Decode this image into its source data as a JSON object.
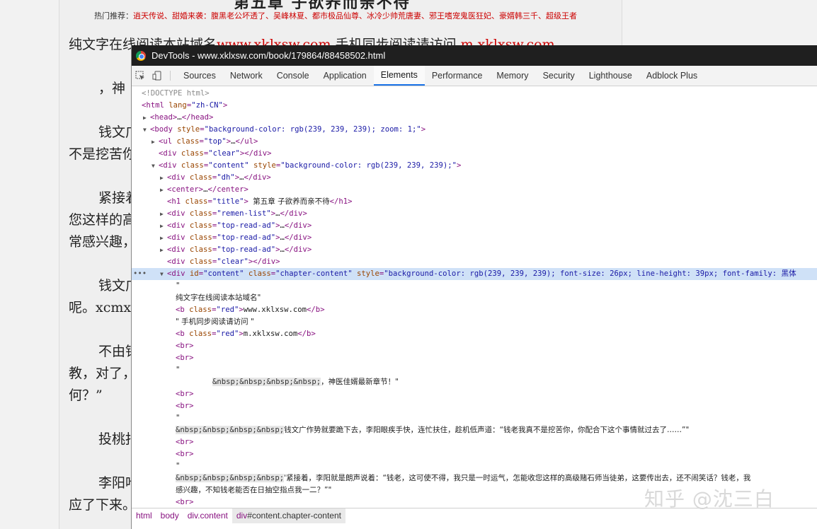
{
  "page": {
    "chapter_title": "第五章 子欲养而亲不待",
    "hot_label": "热门推荐：",
    "hot_links": "逍天传说、甜婚来袭：腹黑老公坏透了、吴峰林夏、都市极品仙尊、冰冷少帅荒唐妻、邪王嗜宠鬼医狂妃、豪婿韩三千、超级王者",
    "lines": [
      {
        "pre": "纯文字在线阅读本站域名",
        "red1": "www.xklxsw.com",
        "mid": "手机同步阅读请访问",
        "red2": "m.xklxsw.com"
      },
      {
        "text": "，神"
      },
      {
        "text": "钱文广"
      },
      {
        "text": "不是挖苦你"
      },
      {
        "text": "紧接着"
      },
      {
        "text": "您这样的高"
      },
      {
        "text": "常感兴趣，"
      },
      {
        "text": "钱文广"
      },
      {
        "text": "呢。xcmx"
      },
      {
        "text": "不由钱"
      },
      {
        "text": "教，对了，"
      },
      {
        "text": "何？”"
      },
      {
        "text": "投桃报"
      },
      {
        "text": "李阳哈"
      },
      {
        "text": "应了下来。"
      }
    ]
  },
  "devtools": {
    "window_title": "DevTools - www.xklxsw.com/book/179864/88458502.html",
    "tabs": [
      "Sources",
      "Network",
      "Console",
      "Application",
      "Elements",
      "Performance",
      "Memory",
      "Security",
      "Lighthouse",
      "Adblock Plus"
    ],
    "active_tab": "Elements",
    "dom": {
      "doctype": "<!DOCTYPE html>",
      "html_open": "html",
      "lang_attr": "lang",
      "lang_val": "\"zh-CN\"",
      "head": "head",
      "body": "body",
      "style_attr": "style",
      "class_attr": "class",
      "id_attr": "id",
      "body_style": "\"background-color: rgb(239, 239, 239); zoom: 1;\"",
      "ul": "ul",
      "top": "\"top\"",
      "div": "div",
      "clear": "\"clear\"",
      "content_cls": "\"content\"",
      "content_style": "\"background-color: rgb(239, 239, 239);\"",
      "dh": "\"dh\"",
      "center": "center",
      "h1": "h1",
      "title_cls": "\"title\"",
      "h1_text": "第五章 子欲养而亲不待",
      "remen": "\"remen-list\"",
      "topad": "\"top-read-ad\"",
      "content_id": "\"content\"",
      "chapter_cls": "\"chapter-content\"",
      "chapter_style": "\"background-color: rgb(239, 239, 239); font-size: 26px; line-height: 39px; font-family: 黑体",
      "quote": "\"",
      "text1": "纯文字在线阅读本站域名\"",
      "b": "b",
      "red_cls": "\"red\"",
      "domain1": "www.xklxsw.com",
      "text2": "\" 手机同步阅读请访问 \"",
      "domain2": "m.xklxsw.com",
      "br": "br",
      "nbsp": "&nbsp;&nbsp;&nbsp;&nbsp;",
      "para1": "，神医佳婿最新章节！\"",
      "para2": "钱文广作势就要跪下去，李阳眼疾手快，连忙扶住，趁机低声道：“钱老我真不是挖苦你，你配合下这个事情就过去了……”\"",
      "para3a": "'紧接着，李阳就是朗声说着：“钱老，这可使不得，我只是一时运气，怎能收您这样的高级赌石师当徒弟，这要传出去，还不闹笑话？钱老，我",
      "para3b": "感兴趣，不知钱老能否在日抽空指点我一二？”\""
    },
    "ellipsis": "…",
    "breadcrumbs": {
      "html": "html",
      "body": "body",
      "content": "div.content",
      "cur_tag": "div",
      "cur_rest": "#content.chapter-content"
    }
  },
  "watermark": "知乎 @沈三白"
}
